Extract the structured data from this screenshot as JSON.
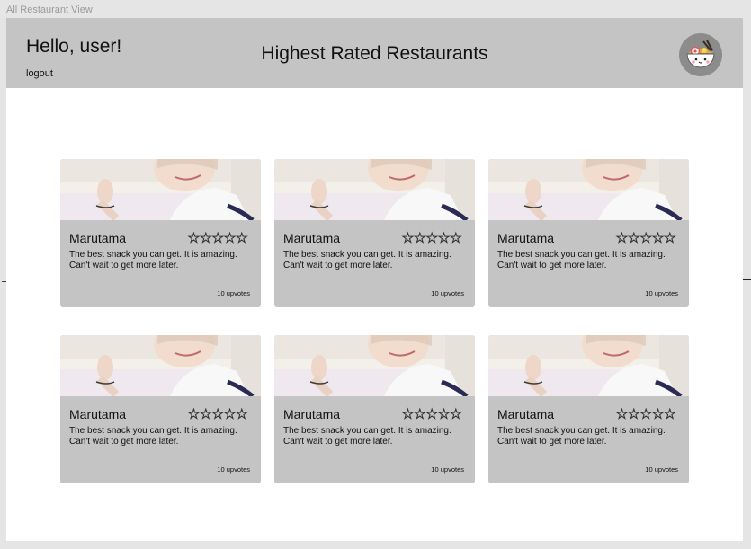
{
  "frame_label": "All Restaurant View",
  "header": {
    "greeting": "Hello, user!",
    "logout_label": "logout",
    "title": "Highest Rated Restaurants"
  },
  "colors": {
    "header_bg": "#c4c4c4",
    "card_bg": "#c4c4c4",
    "avatar_bg": "#8c8c8c",
    "star": "#f6d200"
  },
  "cards": [
    {
      "name": "Marutama",
      "rating": "☆☆☆☆☆",
      "description": "The best snack you can get. It is amazing. Can't wait to get more later.",
      "upvotes": "10 upvotes"
    },
    {
      "name": "Marutama",
      "rating": "☆☆☆☆☆",
      "description": "The best snack you can get. It is amazing. Can't wait to get more later.",
      "upvotes": "10 upvotes"
    },
    {
      "name": "Marutama",
      "rating": "☆☆☆☆☆",
      "description": "The best snack you can get. It is amazing. Can't wait to get more later.",
      "upvotes": "10 upvotes"
    },
    {
      "name": "Marutama",
      "rating": "☆☆☆☆☆",
      "description": "The best snack you can get. It is amazing. Can't wait to get more later.",
      "upvotes": "10 upvotes"
    },
    {
      "name": "Marutama",
      "rating": "☆☆☆☆☆",
      "description": "The best snack you can get. It is amazing. Can't wait to get more later.",
      "upvotes": "10 upvotes"
    },
    {
      "name": "Marutama",
      "rating": "☆☆☆☆☆",
      "description": "The best snack you can get. It is amazing. Can't wait to get more later.",
      "upvotes": "10 upvotes"
    }
  ]
}
